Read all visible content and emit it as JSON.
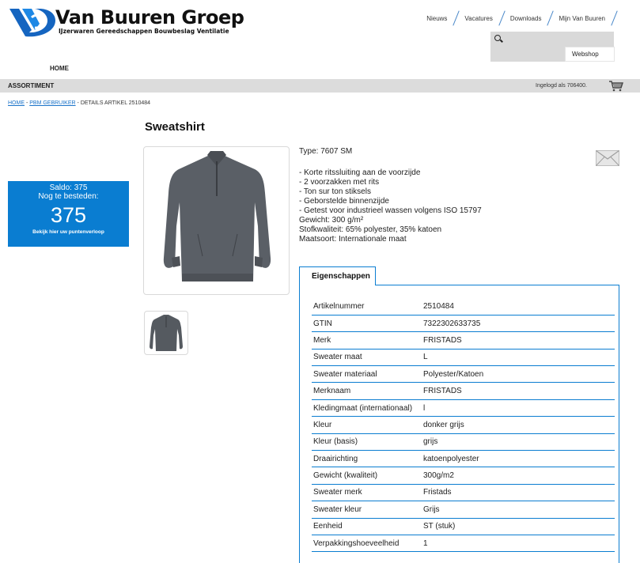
{
  "header": {
    "brand": "Van Buuren Groep",
    "tagline": "IJzerwaren Gereedschappen Bouwbeslag Ventilatie",
    "nav": [
      "Nieuws",
      "Vacatures",
      "Downloads",
      "Mijn Van Buuren"
    ],
    "search_placeholder": "",
    "webshop_label": "Webshop",
    "home_label": "HOME"
  },
  "menubar": {
    "assortiment_label": "ASSORTIMENT",
    "logged_in_text": "Ingelogd als 706400."
  },
  "breadcrumb": {
    "home": "HOME",
    "sep1": " - ",
    "pbm": "PBM GEBRUIKER",
    "sep2": " - ",
    "current": "DETAILS ARTIKEL 2510484"
  },
  "product": {
    "title": "Sweatshirt",
    "type_line": "Type: 7607 SM",
    "features": [
      "- Korte ritssluiting aan de voorzijde",
      "- 2 voorzakken met rits",
      "- Ton sur ton stiksels",
      "- Geborstelde binnenzijde",
      "- Getest voor industrieel wassen volgens ISO 15797",
      "Gewicht: 300 g/m²",
      "Stofkwaliteit: 65% polyester, 35% katoen",
      "Maatsoort: Internationale maat"
    ]
  },
  "saldo": {
    "line1": "Saldo: 375",
    "line2": "Nog te besteden:",
    "amount": "375",
    "link": "Bekijk hier uw puntenverloop"
  },
  "tabs": {
    "eigenschappen": "Eigenschappen"
  },
  "properties": [
    [
      "Artikelnummer",
      "2510484"
    ],
    [
      "GTIN",
      "7322302633735"
    ],
    [
      "Merk",
      "FRISTADS"
    ],
    [
      "Sweater maat",
      "L"
    ],
    [
      "Sweater materiaal",
      "Polyester/Katoen"
    ],
    [
      "Merknaam",
      "FRISTADS"
    ],
    [
      "Kledingmaat (internationaal)",
      "l"
    ],
    [
      "Kleur",
      "donker grijs"
    ],
    [
      "Kleur (basis)",
      "grijs"
    ],
    [
      "Draairichting",
      "katoenpolyester"
    ],
    [
      "Gewicht (kwaliteit)",
      "300g/m2"
    ],
    [
      "Sweater merk",
      "Fristads"
    ],
    [
      "Sweater kleur",
      "Grijs"
    ],
    [
      "Eenheid",
      "ST (stuk)"
    ],
    [
      "Verpakkingshoeveelheid",
      "1"
    ]
  ],
  "colors": {
    "accent": "#0a7dd1",
    "menubar": "#dcdcdc",
    "link": "#1a73c9"
  },
  "icons": [
    "logo-icon",
    "search-icon",
    "cart-icon",
    "mail-icon"
  ]
}
